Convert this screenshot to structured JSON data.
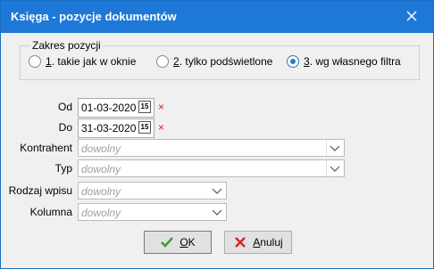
{
  "window": {
    "title": "Księga - pozycje dokumentów"
  },
  "range_group": {
    "legend": "Zakres pozycji",
    "options": [
      {
        "key": "1",
        "rest": ". takie jak w oknie",
        "selected": false
      },
      {
        "key": "2",
        "rest": ". tylko podświetlone",
        "selected": false
      },
      {
        "key": "3",
        "rest": ". wg własnego filtra",
        "selected": true
      }
    ]
  },
  "form": {
    "od_label": "Od",
    "od_value": "01-03-2020",
    "do_label": "Do",
    "do_value": "31-03-2020",
    "kontrahent_label": "Kontrahent",
    "kontrahent_value": "dowolny",
    "typ_label": "Typ",
    "typ_value": "dowolny",
    "rodzaj_label": "Rodzaj wpisu",
    "rodzaj_value": "dowolny",
    "kolumna_label": "Kolumna",
    "kolumna_value": "dowolny",
    "calendar_glyph": "15",
    "clear_glyph": "×"
  },
  "buttons": {
    "ok_key": "O",
    "ok_rest": "K",
    "cancel_key": "A",
    "cancel_rest": "nuluj"
  },
  "colors": {
    "titlebar": "#1e78d7",
    "accent": "#2f79c9",
    "clear": "#dd2222",
    "ok_check": "#3aa13a"
  }
}
